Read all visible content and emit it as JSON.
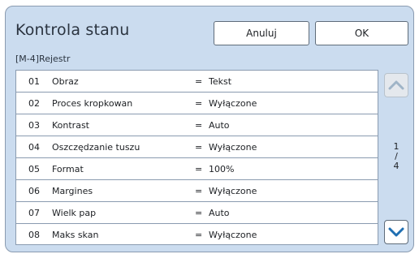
{
  "dialog": {
    "title": "Kontrola stanu",
    "cancel_label": "Anuluj",
    "ok_label": "OK",
    "subtitle": "[M-4]Rejestr"
  },
  "rows": [
    {
      "num": "01",
      "name": "Obraz",
      "eq": "=",
      "value": "Tekst"
    },
    {
      "num": "02",
      "name": "Proces kropkowan",
      "eq": "=",
      "value": "Wyłączone"
    },
    {
      "num": "03",
      "name": "Kontrast",
      "eq": "=",
      "value": "Auto"
    },
    {
      "num": "04",
      "name": "Oszczędzanie tuszu",
      "eq": "=",
      "value": "Wyłączone"
    },
    {
      "num": "05",
      "name": "Format",
      "eq": "=",
      "value": "100%"
    },
    {
      "num": "06",
      "name": "Margines",
      "eq": "=",
      "value": "Wyłączone"
    },
    {
      "num": "07",
      "name": "Wielk pap",
      "eq": "=",
      "value": "Auto"
    },
    {
      "num": "08",
      "name": "Maks skan",
      "eq": "=",
      "value": "Wyłączone"
    }
  ],
  "pagination": {
    "current": "1",
    "separator": "/",
    "total": "4"
  },
  "icons": {
    "scroll_up": "chevron-up-icon",
    "scroll_down": "chevron-down-icon"
  },
  "colors": {
    "panel_bg": "#cbdcef",
    "chevron_active": "#1f6fb2",
    "chevron_disabled": "#9fb4c7"
  }
}
